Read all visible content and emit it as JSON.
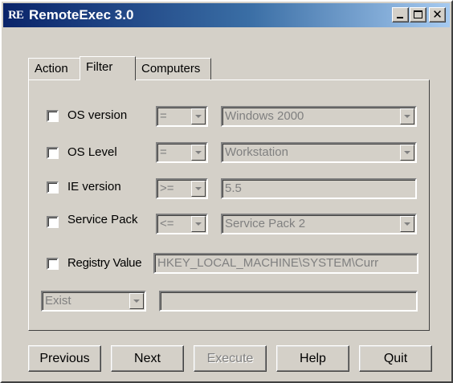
{
  "window": {
    "logo": "RE",
    "title": "RemoteExec 3.0",
    "controls": {
      "minimize": "minimize",
      "maximize": "maximize",
      "close": "close"
    }
  },
  "tabs": [
    {
      "label": "Action",
      "active": false
    },
    {
      "label": "Filter",
      "active": true
    },
    {
      "label": "Computers",
      "active": false
    }
  ],
  "filters": {
    "os_version": {
      "label": "OS version",
      "checked": false,
      "operator": "=",
      "value": "Windows 2000"
    },
    "os_level": {
      "label": "OS Level",
      "checked": false,
      "operator": "=",
      "value": "Workstation"
    },
    "ie_version": {
      "label": "IE version",
      "checked": false,
      "operator": ">=",
      "value": "5.5"
    },
    "service_pack": {
      "label": "Service Pack",
      "checked": false,
      "operator": "<=",
      "value": "Service Pack 2"
    },
    "registry_value": {
      "label": "Registry Value",
      "checked": false,
      "key": "HKEY_LOCAL_MACHINE\\SYSTEM\\Curr"
    },
    "registry_condition": {
      "operator": "Exist",
      "value": ""
    }
  },
  "buttons": {
    "previous": "Previous",
    "next": "Next",
    "execute": "Execute",
    "help": "Help",
    "quit": "Quit"
  },
  "colors": {
    "face": "#d4d0c8",
    "title_gradient_start": "#0a246a",
    "title_gradient_end": "#a6caf0",
    "disabled_text": "#808080"
  }
}
